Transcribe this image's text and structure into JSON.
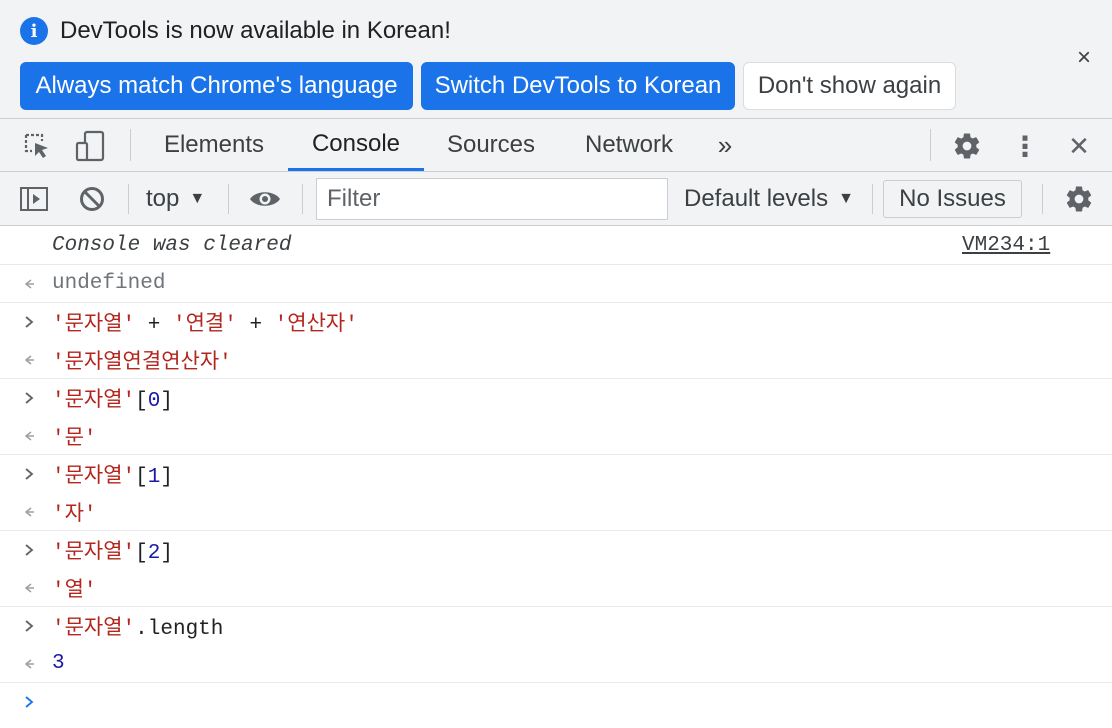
{
  "banner": {
    "message": "DevTools is now available in Korean!",
    "info_icon": "i",
    "close": "×",
    "buttons": {
      "always_match": "Always match Chrome's language",
      "switch": "Switch DevTools to Korean",
      "dont_show": "Don't show again"
    }
  },
  "main_toolbar": {
    "tabs": [
      "Elements",
      "Console",
      "Sources",
      "Network"
    ],
    "active_tab": "Console",
    "more_tabs": "»",
    "more_menu": "⋮",
    "close": "✕"
  },
  "console_toolbar": {
    "context": "top",
    "filter_placeholder": "Filter",
    "levels": "Default levels",
    "issues": "No Issues"
  },
  "console": {
    "cleared_message": "Console was cleared",
    "cleared_source": "VM234:1",
    "entries": [
      {
        "type": "output",
        "value": "undefined"
      },
      {
        "type": "input",
        "parts": [
          "'문자열'",
          " + ",
          "'연결'",
          " + ",
          "'연산자'"
        ]
      },
      {
        "type": "output",
        "value": "'문자열연결연산자'"
      },
      {
        "type": "input",
        "parts": [
          "'문자열'",
          "[",
          "0",
          "]"
        ]
      },
      {
        "type": "output",
        "value": "'문'"
      },
      {
        "type": "input",
        "parts": [
          "'문자열'",
          "[",
          "1",
          "]"
        ]
      },
      {
        "type": "output",
        "value": "'자'"
      },
      {
        "type": "input",
        "parts": [
          "'문자열'",
          "[",
          "2",
          "]"
        ]
      },
      {
        "type": "output",
        "value": "'열'"
      },
      {
        "type": "input",
        "parts": [
          "'문자열'",
          ".length"
        ]
      },
      {
        "type": "output",
        "value": "3"
      }
    ]
  },
  "colors": {
    "accent": "#1a73e8",
    "string": "#b3261e",
    "number": "#1a1aa6",
    "toolbar_bg": "#f1f3f4"
  }
}
